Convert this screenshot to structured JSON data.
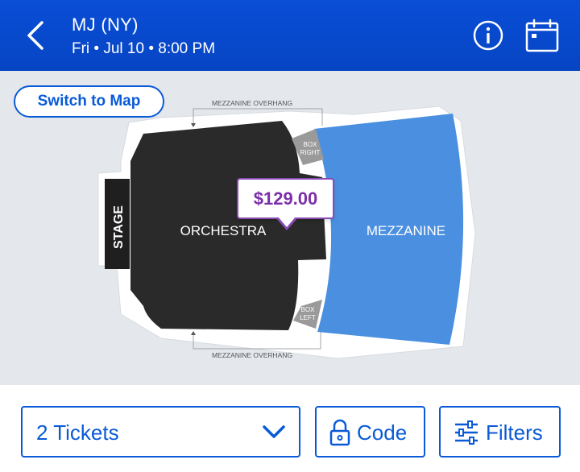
{
  "header": {
    "title": "MJ (NY)",
    "subtitle": "Fri • Jul 10 • 8:00 PM",
    "background": "#0a4ed6"
  },
  "map": {
    "switch_label": "Switch to Map",
    "stage_label": "STAGE",
    "orchestra_label": "ORCHESTRA",
    "mezzanine_label": "MEZZANINE",
    "box_right_label": [
      "BOX",
      "RIGHT"
    ],
    "box_left_label": [
      "BOX",
      "LEFT"
    ],
    "overhang_top": "MEZZANINE OVERHANG",
    "overhang_bottom": "MEZZANINE OVERHANG",
    "price": "$129.00",
    "colors": {
      "orchestra": "#2a2a2a",
      "mezzanine": "#4a8fe0",
      "box": "#9a9a9a",
      "price_accent": "#7b2fa8"
    }
  },
  "footer": {
    "tickets_label": "2 Tickets",
    "code_label": "Code",
    "filters_label": "Filters",
    "accent": "#0a5ad8"
  },
  "icons": [
    "back-chevron-icon",
    "info-icon",
    "calendar-icon",
    "chevron-down-icon",
    "lock-icon",
    "filters-sliders-icon"
  ]
}
